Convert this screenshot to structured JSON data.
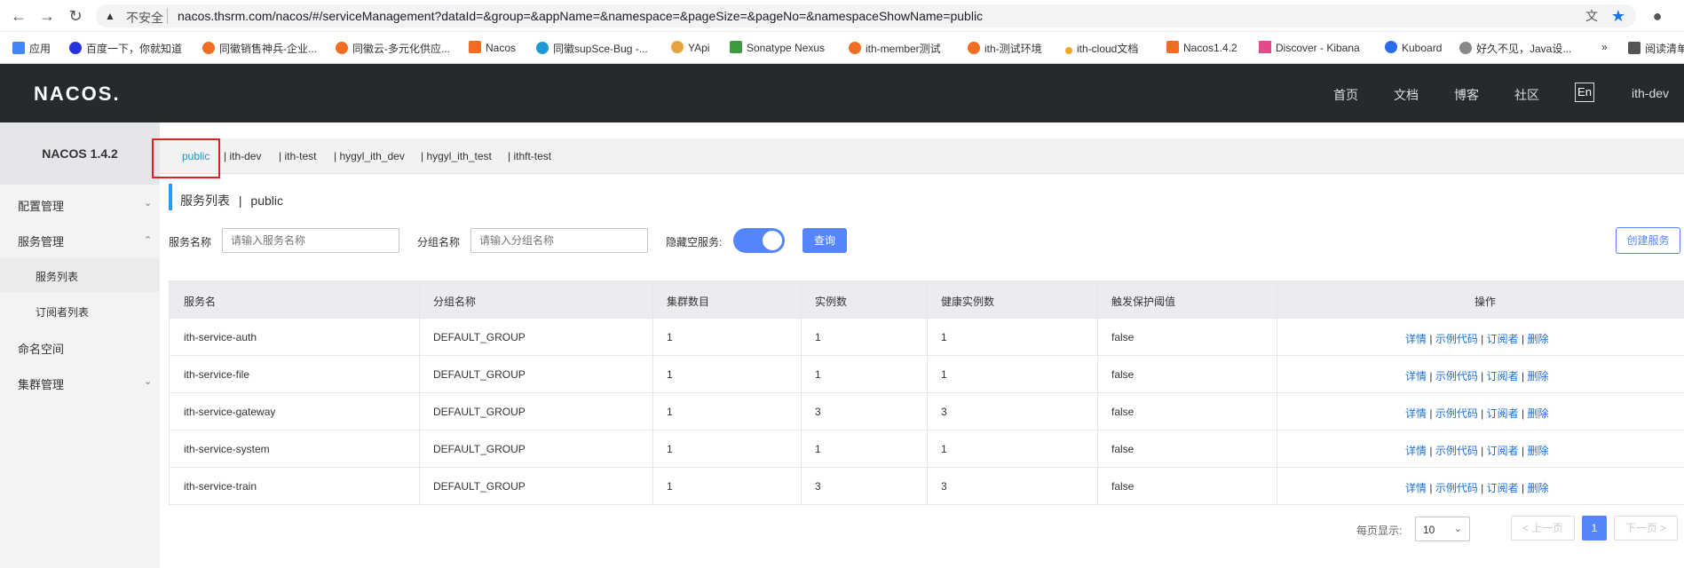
{
  "browser": {
    "insecure_label": "不安全",
    "url": "nacos.thsrm.com/nacos/#/serviceManagement?dataId=&group=&appName=&namespace=&pageSize=&pageNo=&namespaceShowName=public"
  },
  "bookmarks": [
    "应用",
    "百度一下，你就知道",
    "同徽销售神兵-企业...",
    "同徽云-多元化供应...",
    "Nacos",
    "同徽supSce-Bug -...",
    "YApi",
    "Sonatype Nexus",
    "ith-member测试",
    "ith-测试环境",
    "ith-cloud文档",
    "Nacos1.4.2",
    "Discover - Kibana",
    "Kuboard",
    "好久不见，Java设...",
    "»",
    "阅读清单"
  ],
  "header": {
    "logo": "NACOS.",
    "nav": [
      "首页",
      "文档",
      "博客",
      "社区"
    ],
    "lang": "En",
    "user": "ith-dev"
  },
  "sidebar": {
    "title": "NACOS 1.4.2",
    "items": [
      "配置管理",
      "服务管理",
      "服务列表",
      "订阅者列表",
      "命名空间",
      "集群管理"
    ]
  },
  "namespaces": [
    "public",
    "ith-dev",
    "ith-test",
    "hygyl_ith_dev",
    "hygyl_ith_test",
    "ithft-test"
  ],
  "page": {
    "title": "服务列表",
    "sep": "|",
    "namespace": "public"
  },
  "filters": {
    "service_label": "服务名称",
    "service_placeholder": "请输入服务名称",
    "group_label": "分组名称",
    "group_placeholder": "请输入分组名称",
    "hide_empty_label": "隐藏空服务:",
    "query_button": "查询",
    "create_button": "创建服务"
  },
  "table": {
    "headers": [
      "服务名",
      "分组名称",
      "集群数目",
      "实例数",
      "健康实例数",
      "触发保护阈值",
      "操作"
    ],
    "rows": [
      [
        "ith-service-auth",
        "DEFAULT_GROUP",
        "1",
        "1",
        "1",
        "false"
      ],
      [
        "ith-service-file",
        "DEFAULT_GROUP",
        "1",
        "1",
        "1",
        "false"
      ],
      [
        "ith-service-gateway",
        "DEFAULT_GROUP",
        "1",
        "3",
        "3",
        "false"
      ],
      [
        "ith-service-system",
        "DEFAULT_GROUP",
        "1",
        "1",
        "1",
        "false"
      ],
      [
        "ith-service-train",
        "DEFAULT_GROUP",
        "1",
        "3",
        "3",
        "false"
      ]
    ],
    "actions": [
      "详情",
      "示例代码",
      "订阅者",
      "删除"
    ]
  },
  "pagination": {
    "size_label": "每页显示:",
    "size": "10",
    "prev": "上一页",
    "current": "1",
    "next": "下一页"
  }
}
